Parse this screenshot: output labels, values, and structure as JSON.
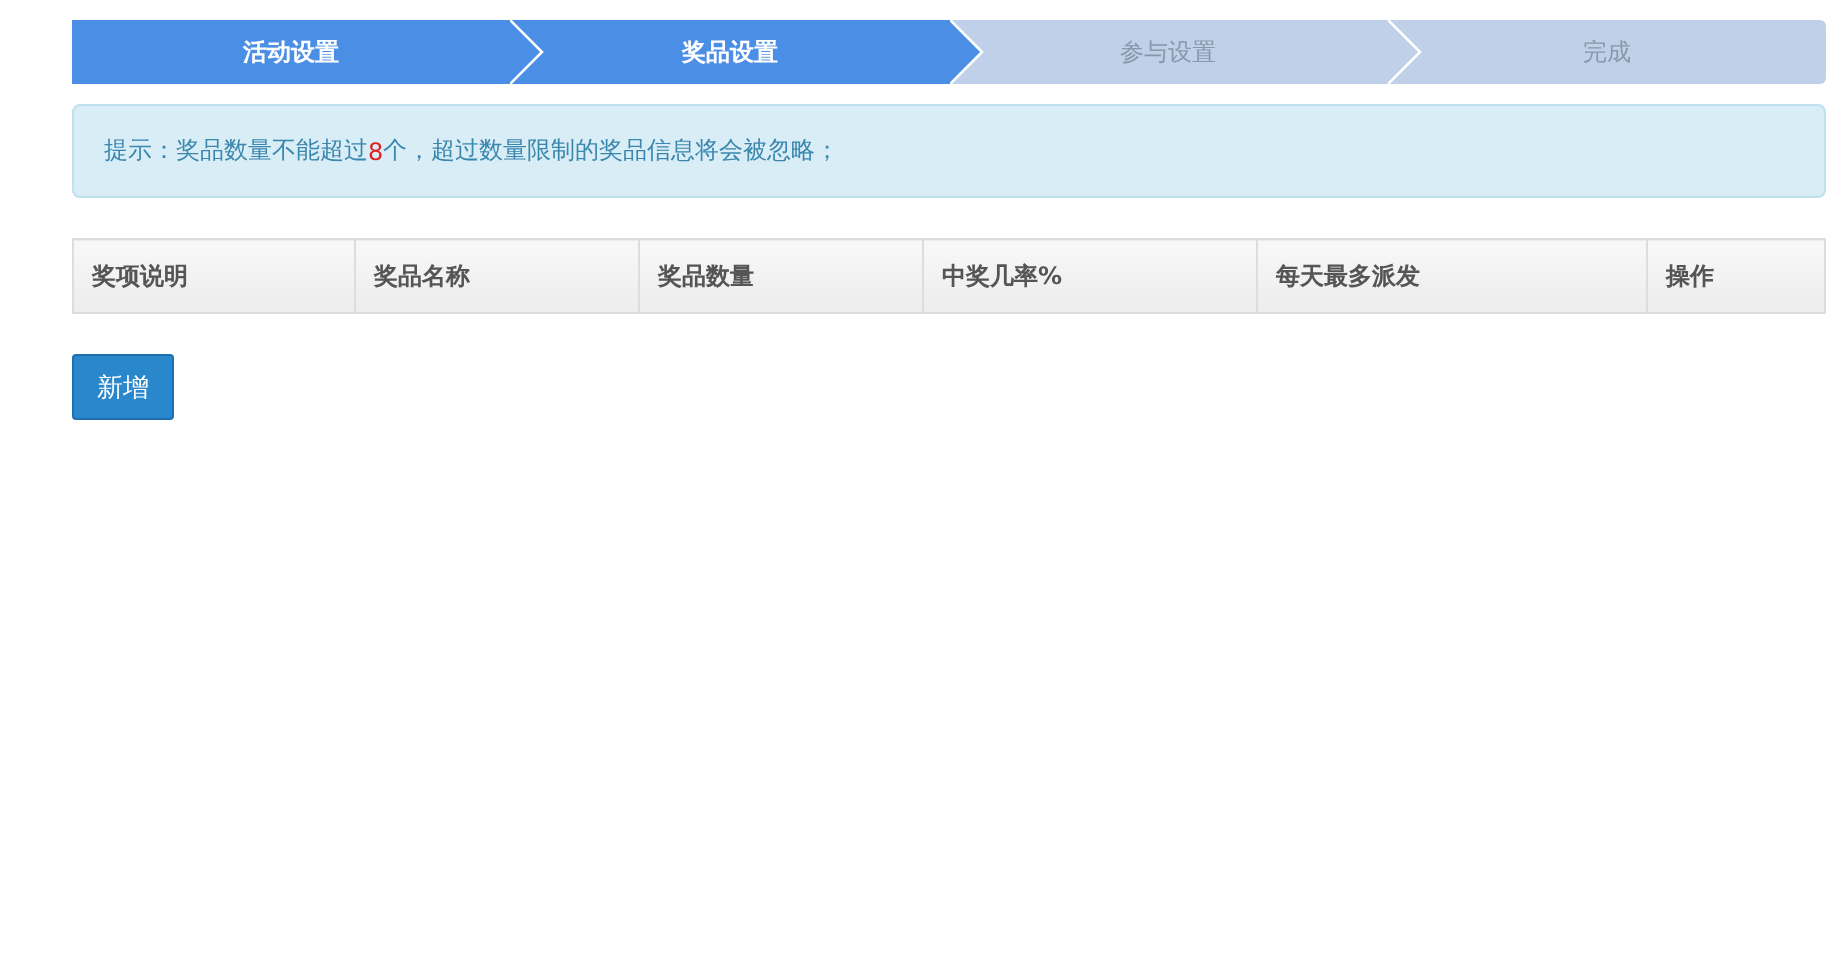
{
  "steps": [
    {
      "label": "活动设置",
      "active": true
    },
    {
      "label": "奖品设置",
      "active": true
    },
    {
      "label": "参与设置",
      "active": false
    },
    {
      "label": "完成",
      "active": false
    }
  ],
  "notice": {
    "before": "提示：奖品数量不能超过",
    "highlight": "8",
    "after": "个，超过数量限制的奖品信息将会被忽略；"
  },
  "table": {
    "columns": [
      "奖项说明",
      "奖品名称",
      "奖品数量",
      "中奖几率%",
      "每天最多派发",
      "操作"
    ]
  },
  "buttons": [
    "新增"
  ]
}
